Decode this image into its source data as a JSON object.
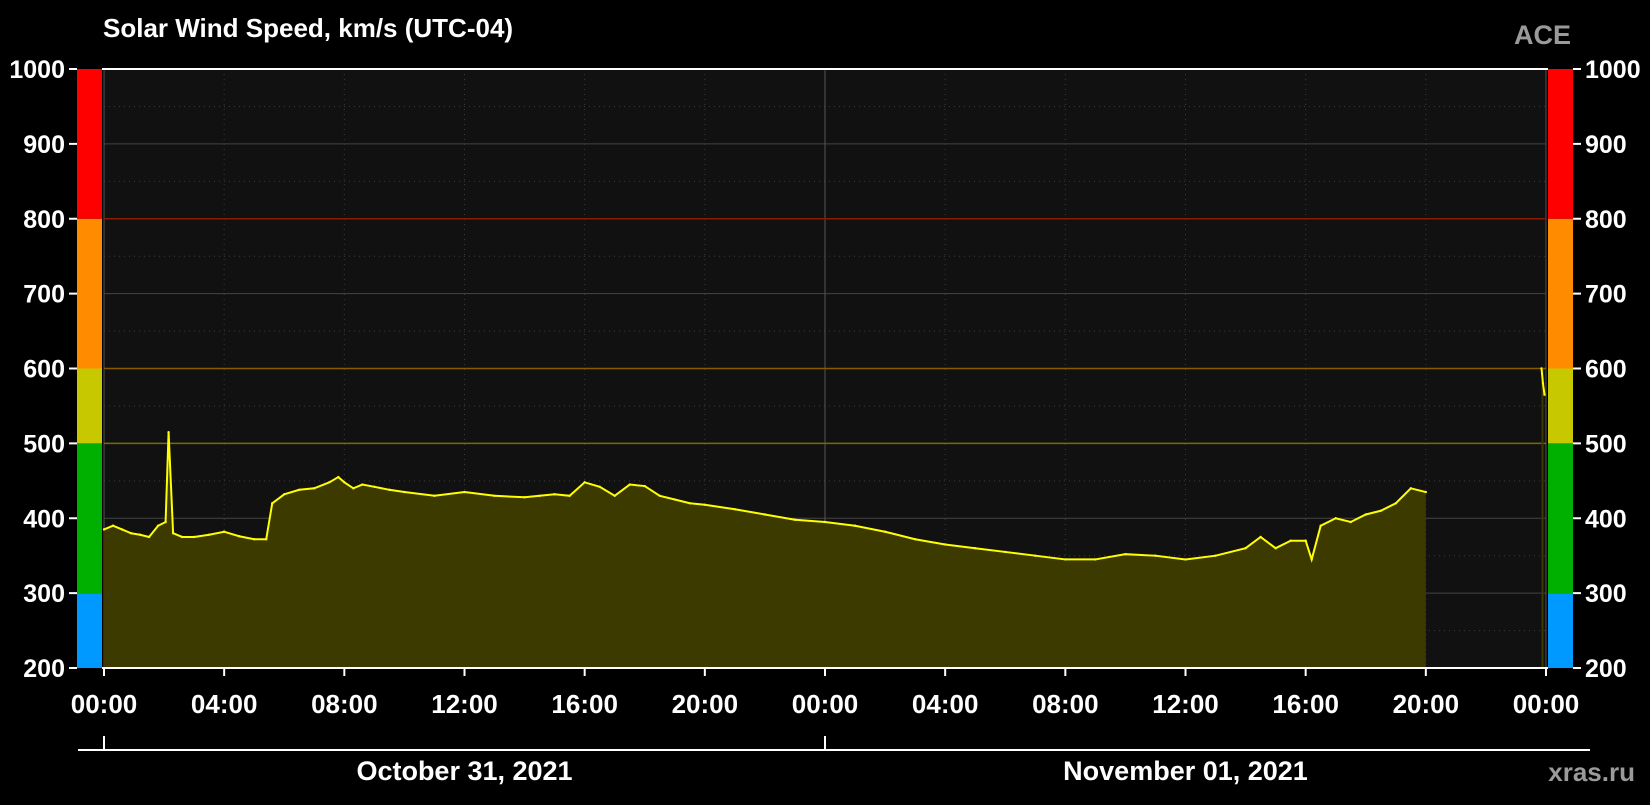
{
  "chart_data": {
    "type": "area",
    "title": "Solar Wind Speed, km/s (UTC-04)",
    "source": "ACE",
    "credit": "xras.ru",
    "y_ticks": [
      200,
      300,
      400,
      500,
      600,
      700,
      800,
      900,
      1000
    ],
    "ylim": [
      200,
      1000
    ],
    "xlim_hours": [
      0,
      48
    ],
    "x_ticks": [
      "00:00",
      "04:00",
      "08:00",
      "12:00",
      "16:00",
      "20:00",
      "00:00",
      "04:00",
      "08:00",
      "12:00",
      "16:00",
      "20:00",
      "00:00"
    ],
    "dates": [
      {
        "label": "October 31, 2021"
      },
      {
        "label": "November 01, 2021"
      }
    ],
    "thresholds": [
      500,
      600,
      800
    ],
    "color_bands": [
      {
        "from": 200,
        "to": 300,
        "color": "#0099ff"
      },
      {
        "from": 300,
        "to": 500,
        "color": "#00b000"
      },
      {
        "from": 500,
        "to": 600,
        "color": "#c8c800"
      },
      {
        "from": 600,
        "to": 800,
        "color": "#ff8c00"
      },
      {
        "from": 800,
        "to": 1000,
        "color": "#ff0000"
      }
    ],
    "colors": {
      "line": "#ffff00",
      "fill": "#3d3a00",
      "plot_bg": "#111111",
      "grid": "#444444",
      "threshold_yellow": "#7a6a00",
      "threshold_orange": "#8a5a00",
      "threshold_red": "#8a1a00"
    },
    "series": [
      {
        "x_hours": [
          0.0,
          0.3,
          0.6,
          0.9,
          1.2,
          1.5,
          1.8,
          2.05,
          2.15,
          2.3,
          2.6,
          3.0,
          3.5,
          4.0,
          4.5,
          5.0,
          5.4,
          5.6,
          6.0,
          6.5,
          7.0,
          7.5,
          7.8,
          8.0,
          8.3,
          8.6,
          9.0,
          9.5,
          10.0,
          11.0,
          12.0,
          13.0,
          14.0,
          14.5,
          15.0,
          15.5,
          16.0,
          16.5,
          17.0,
          17.5,
          18.0,
          18.5,
          19.0,
          19.5,
          20.0,
          21.0,
          22.0,
          23.0,
          24.0,
          25.0,
          26.0,
          27.0,
          28.0,
          29.0,
          30.0,
          31.0,
          32.0,
          33.0,
          34.0,
          35.0,
          36.0,
          37.0,
          38.0,
          38.5,
          39.0,
          39.5,
          40.0,
          40.2,
          40.5,
          41.0,
          41.5,
          42.0,
          42.5,
          43.0,
          43.5,
          44.0
        ],
        "values": [
          385,
          390,
          385,
          380,
          378,
          375,
          390,
          395,
          515,
          380,
          375,
          375,
          378,
          382,
          376,
          372,
          372,
          420,
          432,
          438,
          440,
          448,
          455,
          448,
          440,
          445,
          442,
          438,
          435,
          430,
          435,
          430,
          428,
          430,
          432,
          430,
          448,
          442,
          430,
          445,
          443,
          430,
          425,
          420,
          418,
          412,
          405,
          398,
          395,
          390,
          382,
          372,
          365,
          360,
          355,
          350,
          345,
          345,
          352,
          350,
          345,
          350,
          360,
          375,
          360,
          370,
          370,
          345,
          390,
          400,
          395,
          405,
          410,
          420,
          440,
          435
        ]
      },
      {
        "x_hours": [
          47.85,
          47.9,
          47.95
        ],
        "values": [
          600,
          580,
          565
        ]
      }
    ]
  }
}
